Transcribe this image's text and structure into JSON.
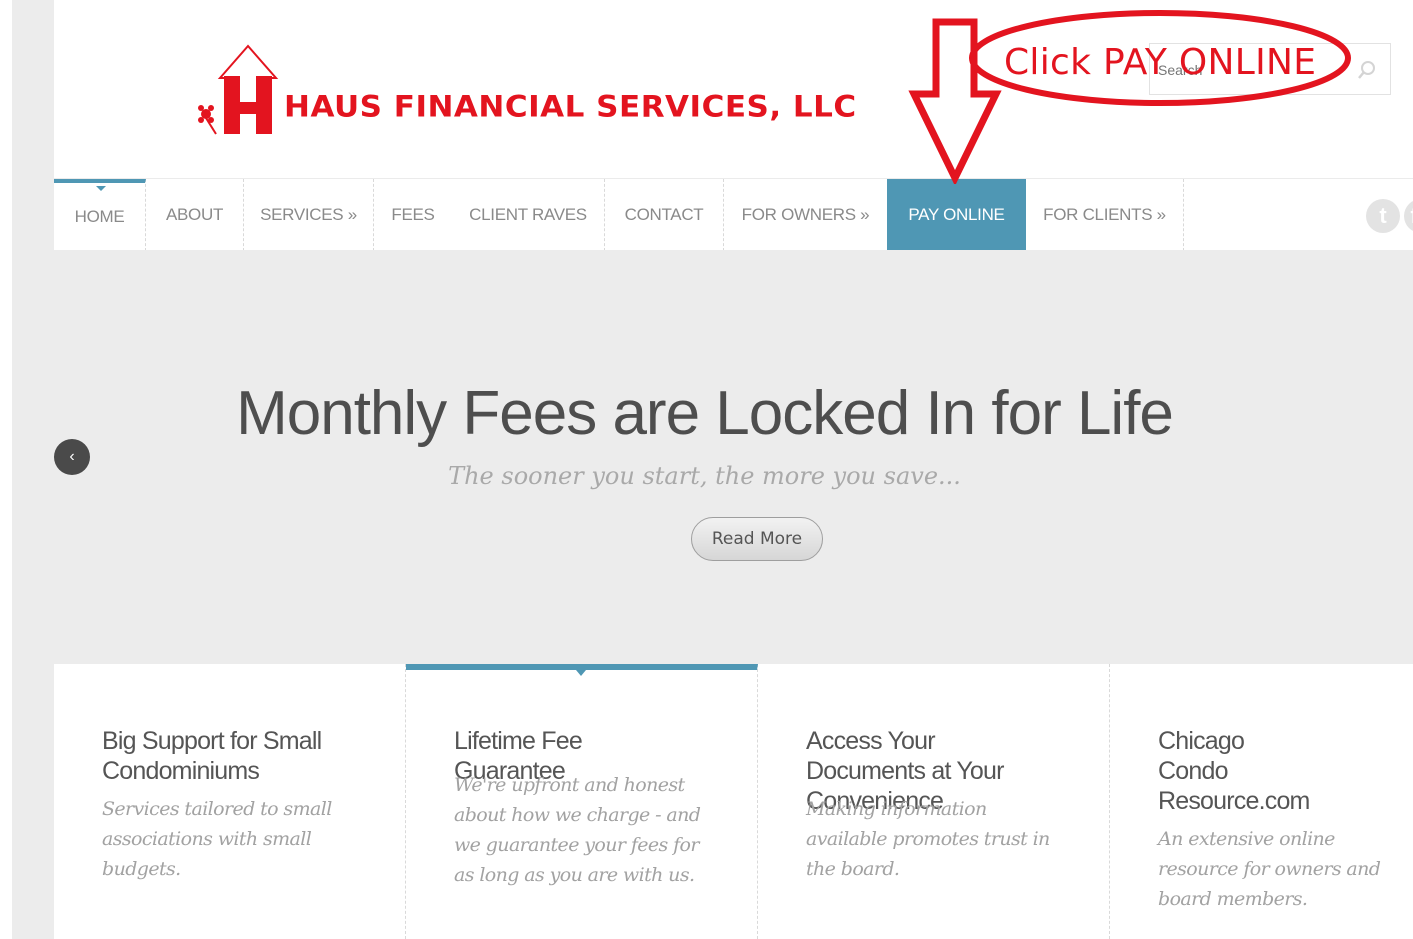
{
  "header": {
    "logo_text": "HAUS FINANCIAL SERVICES, LLC",
    "logo_letter": "H",
    "search_placeholder": "Search"
  },
  "nav": {
    "items": [
      {
        "label": "HOME"
      },
      {
        "label": "ABOUT"
      },
      {
        "label": "SERVICES »"
      },
      {
        "label": "FEES"
      },
      {
        "label": "CLIENT RAVES"
      },
      {
        "label": "CONTACT"
      },
      {
        "label": "FOR OWNERS »"
      },
      {
        "label": "PAY ONLINE"
      },
      {
        "label": "FOR CLIENTS »"
      }
    ],
    "active": "PAY ONLINE",
    "accent_color": "#4f97b4"
  },
  "social": {
    "icons": [
      "twitter-icon",
      "facebook-icon"
    ]
  },
  "hero": {
    "title": "Monthly Fees are Locked In for Life",
    "subtitle": "The sooner you start, the more you save...",
    "button_label": "Read More",
    "prev_label": "‹"
  },
  "features": [
    {
      "title": "Big Support for Small Condominiums",
      "text": "Services tailored to small associations with small budgets."
    },
    {
      "title": "Lifetime Fee Guarantee",
      "text": "We're upfront and honest about how we charge - and we guarantee your fees for as long as you are with us."
    },
    {
      "title": "Access Your Documents at Your Convenience",
      "text": "Making information available promotes trust in the board."
    },
    {
      "title": "Chicago Condo Resource.com",
      "text": "An extensive online resource for owners and board members."
    }
  ],
  "annotation": {
    "text": "Click PAY ONLINE",
    "color": "#e3141f"
  }
}
